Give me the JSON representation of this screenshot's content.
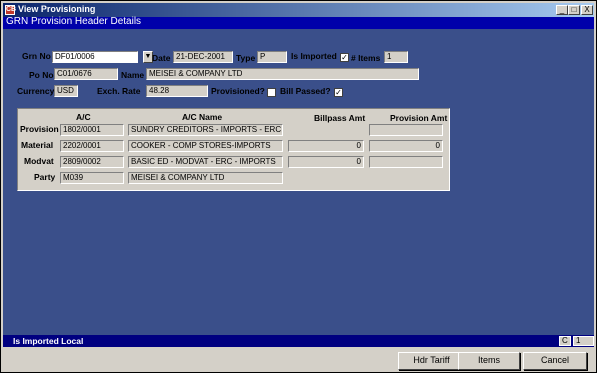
{
  "window": {
    "title": "View Provisioning",
    "app_icon": "CB"
  },
  "form": {
    "heading": "GRN Provision Header Details"
  },
  "header": {
    "grn_no": {
      "label": "Grn No",
      "value": "DF01/0006"
    },
    "date": {
      "label": "Date",
      "value": "21-DEC-2001"
    },
    "type": {
      "label": "Type",
      "value": "P"
    },
    "is_imported": {
      "label": "Is Imported",
      "checked": true
    },
    "num_items": {
      "label": "# Items",
      "value": "1"
    },
    "po_no": {
      "label": "Po No",
      "value": "C01/0676"
    },
    "name": {
      "label": "Name",
      "value": "MEISEI & COMPANY LTD"
    },
    "currency": {
      "label": "Currency",
      "value": "USD"
    },
    "exch_rate": {
      "label": "Exch. Rate",
      "value": "48.28"
    },
    "provisioned": {
      "label": "Provisioned?",
      "checked": false
    },
    "bill_passed": {
      "label": "Bill Passed?",
      "checked": true
    }
  },
  "accounts": {
    "headers": {
      "ac": "A/C",
      "ac_name": "A/C Name",
      "billpass": "Billpass Amt",
      "provision": "Provision Amt"
    },
    "rows": [
      {
        "label": "Provision",
        "ac": "1802/0001",
        "ac_name": "SUNDRY CREDITORS - IMPORTS - ERC",
        "billpass": "",
        "provision": ""
      },
      {
        "label": "Material",
        "ac": "2202/0001",
        "ac_name": "COOKER - COMP STORES-IMPORTS",
        "billpass": "0",
        "provision": "0"
      },
      {
        "label": "Modvat",
        "ac": "2809/0002",
        "ac_name": "BASIC ED - MODVAT - ERC - IMPORTS",
        "billpass": "0",
        "provision": ""
      },
      {
        "label": "Party",
        "ac": "M039",
        "ac_name": "MEISEI & COMPANY LTD"
      }
    ]
  },
  "status": {
    "text": "Is Imported Local",
    "indicator": "C",
    "record": "1"
  },
  "buttons": {
    "hdr_tariff": "Hdr Tariff",
    "items": "Items",
    "cancel": "Cancel"
  },
  "controls": {
    "minimize": "_",
    "maximize": "□",
    "close": "X"
  }
}
